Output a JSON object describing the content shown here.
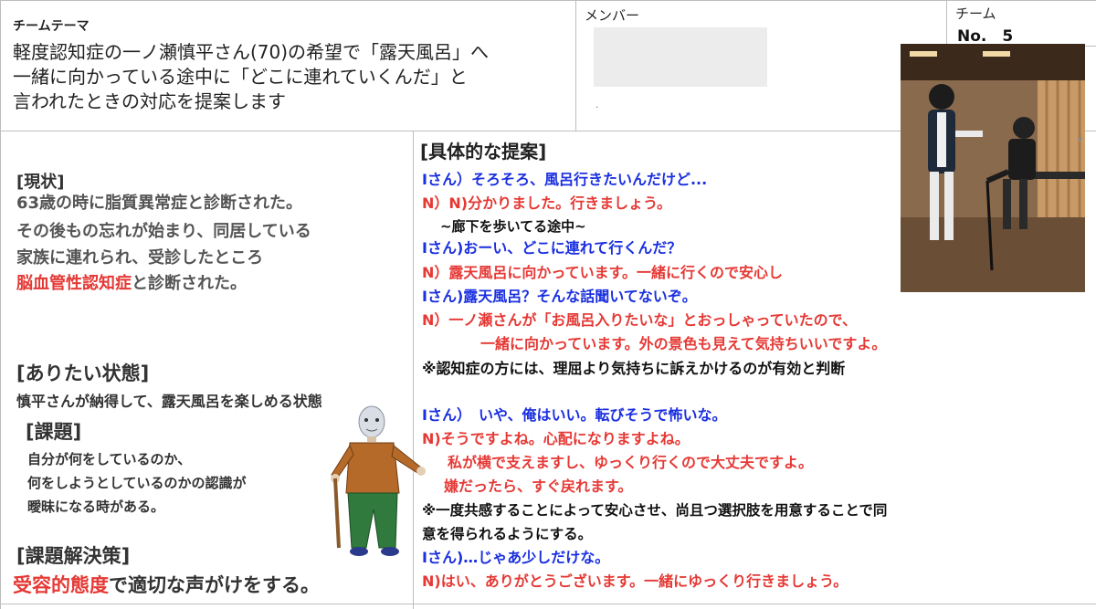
{
  "header": {
    "team_theme_label": "チームテーマ",
    "theme_lines": [
      "軽度認知症の一ノ瀬慎平さん(70)の希望で「露天風呂」へ",
      "一緒に向かっている途中に「どこに連れていくんだ」と",
      "言われたときの対応を提案します"
    ],
    "member_label": "メンバー",
    "team_label": "チーム",
    "team_no": "No.　5"
  },
  "left": {
    "current_title": "[現状]",
    "current_lines": [
      "63歳の時に脂質異常症と診断された。",
      "その後もの忘れが始まり、同居している",
      "家族に連れられ、受診したところ"
    ],
    "current_last_red": "脳血管性認知症",
    "current_last_rest": "と診断された。",
    "ideal_title": "[ありたい状態]",
    "ideal_text": "慎平さんが納得して、露天風呂を楽しめる状態",
    "issue_title": "[課題]",
    "issue_lines": [
      "自分が何をしているのか、",
      "何をしようとしているのかの認識が",
      "曖昧になる時がある。"
    ],
    "solution_title": "[課題解決策]",
    "solution_red": "受容的態度",
    "solution_rest": "で適切な声がけをする。"
  },
  "right": {
    "title": "[具体的な提案]",
    "lines": [
      "Iさん）そろそろ、風呂行きたいんだけど...",
      "N）N)分かりました。行きましょう。",
      "~廊下を歩いてる途中~",
      "Iさん)おーい、どこに連れて行くんだ？",
      "N）露天風呂に向かっています。一緒に行くので安心し",
      "Iさん)露天風呂？そんな話聞いてないぞ。",
      "N）一ノ瀬さんが「お風呂入りたいな」とおっしゃっていたので、",
      "一緒に向かっています。外の景色も見えて気持ちいいですよ。",
      "※認知症の方には、理屈より気持ちに訴えかけるのが有効と判断",
      "Iさん）　いや、俺はいい。転びそうで怖いな。",
      "N)そうですよね。心配になりますよね。",
      "私が横で支えますし、ゆっくり行くので大丈夫ですよ。",
      "嫌だったら、すぐ戻れます。",
      "※一度共感することによって安心させ、尚且つ選択肢を用意することで同",
      "意を得られるようにする。",
      "Iさん)…じゃあ少しだけな。",
      "N)はい、ありがとうございます。一緒にゆっくり行きましょう。"
    ]
  },
  "colors": {
    "blue": "#1a2fe0",
    "red": "#e53935",
    "gray": "#555555"
  }
}
